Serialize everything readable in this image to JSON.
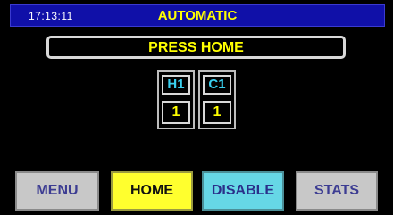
{
  "header": {
    "time": "17:13:11",
    "mode": "AUTOMATIC"
  },
  "message": {
    "text": "PRESS HOME"
  },
  "units": [
    {
      "label": "H1",
      "value": "1"
    },
    {
      "label": "C1",
      "value": "1"
    }
  ],
  "buttons": {
    "menu": "MENU",
    "home": "HOME",
    "disable": "DISABLE",
    "stats": "STATS"
  },
  "colors": {
    "header_bg": "#1010a8",
    "accent_yellow": "#ffff00",
    "accent_cyan": "#3ad0f0",
    "home_button": "#ffff2e",
    "disable_button": "#66d7e6",
    "neutral_button": "#c8c8c8"
  }
}
